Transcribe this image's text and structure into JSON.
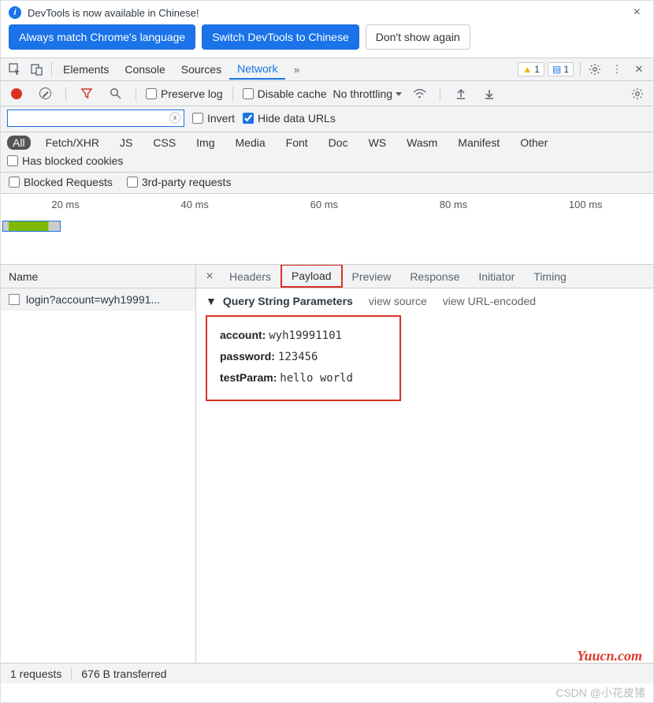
{
  "infobar": {
    "message": "DevTools is now available in Chinese!",
    "btn_match": "Always match Chrome's language",
    "btn_switch": "Switch DevTools to Chinese",
    "btn_dismiss": "Don't show again"
  },
  "main_tabs": {
    "elements": "Elements",
    "console": "Console",
    "sources": "Sources",
    "network": "Network"
  },
  "badges": {
    "warn_count": "1",
    "msg_count": "1"
  },
  "subbar": {
    "preserve": "Preserve log",
    "disable_cache": "Disable cache",
    "throttling": "No throttling"
  },
  "filter": {
    "invert": "Invert",
    "hide_data": "Hide data URLs"
  },
  "types": {
    "all": "All",
    "fetchxhr": "Fetch/XHR",
    "js": "JS",
    "css": "CSS",
    "img": "Img",
    "media": "Media",
    "font": "Font",
    "doc": "Doc",
    "ws": "WS",
    "wasm": "Wasm",
    "manifest": "Manifest",
    "other": "Other",
    "blocked_cookies": "Has blocked cookies",
    "blocked_req": "Blocked Requests",
    "third_party": "3rd-party requests"
  },
  "timeline_ticks": [
    "20 ms",
    "40 ms",
    "60 ms",
    "80 ms",
    "100 ms"
  ],
  "name_header": "Name",
  "request_name": "login?account=wyh19991...",
  "detail_tabs": {
    "headers": "Headers",
    "payload": "Payload",
    "preview": "Preview",
    "response": "Response",
    "initiator": "Initiator",
    "timing": "Timing"
  },
  "payload": {
    "section_title": "Query String Parameters",
    "view_source": "view source",
    "view_url": "view URL-encoded",
    "params": [
      {
        "k": "account:",
        "v": "wyh19991101"
      },
      {
        "k": "password:",
        "v": "123456"
      },
      {
        "k": "testParam:",
        "v": "hello world"
      }
    ]
  },
  "status": {
    "requests": "1 requests",
    "transferred": "676 B transferred"
  },
  "watermark1": "Yuucn.com",
  "watermark2": "CSDN @小花皮猪"
}
